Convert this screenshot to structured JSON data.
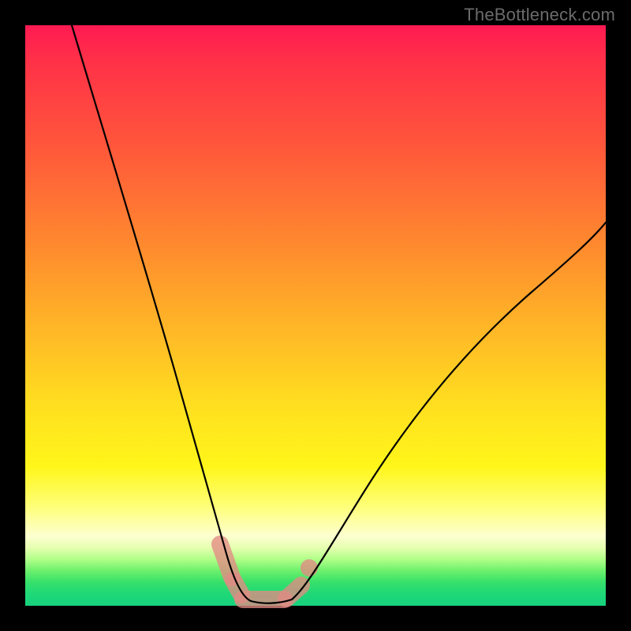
{
  "watermark": "TheBottleneck.com",
  "colors": {
    "background_border": "#000000",
    "curve": "#000000",
    "marker": "#e38a84",
    "gradient_top": "#ff1a52",
    "gradient_bottom": "#17d27e"
  },
  "chart_data": {
    "type": "line",
    "title": "",
    "xlabel": "",
    "ylabel": "",
    "xlim": [
      0,
      100
    ],
    "ylim": [
      0,
      100
    ],
    "grid": false,
    "legend": false,
    "annotations": [
      "TheBottleneck.com"
    ],
    "series": [
      {
        "name": "left-branch",
        "x": [
          8,
          12,
          16,
          20,
          24,
          27,
          29,
          31,
          33,
          34.5,
          36,
          37.5
        ],
        "y": [
          100,
          86,
          73,
          60,
          46,
          34,
          25,
          17,
          10,
          6,
          3,
          1
        ]
      },
      {
        "name": "valley-floor",
        "x": [
          37.5,
          40,
          43,
          46
        ],
        "y": [
          1,
          0.5,
          0.6,
          1.2
        ]
      },
      {
        "name": "right-branch",
        "x": [
          46,
          50,
          55,
          60,
          66,
          74,
          84,
          94,
          100
        ],
        "y": [
          1.2,
          6,
          14,
          22,
          31,
          42,
          53,
          62,
          67
        ]
      }
    ],
    "markers": {
      "name": "highlighted-segments",
      "color": "#e38a84",
      "segments": [
        {
          "x": [
            33.5,
            35.5
          ],
          "y": [
            11,
            5
          ]
        },
        {
          "x": [
            35.8,
            37.2
          ],
          "y": [
            4.5,
            2
          ]
        },
        {
          "x": [
            37.5,
            44.5
          ],
          "y": [
            1,
            1
          ]
        },
        {
          "x": [
            45,
            47.5
          ],
          "y": [
            1.2,
            3.5
          ]
        },
        {
          "x": [
            48.5,
            49.5
          ],
          "y": [
            5.5,
            7.5
          ]
        }
      ]
    }
  }
}
